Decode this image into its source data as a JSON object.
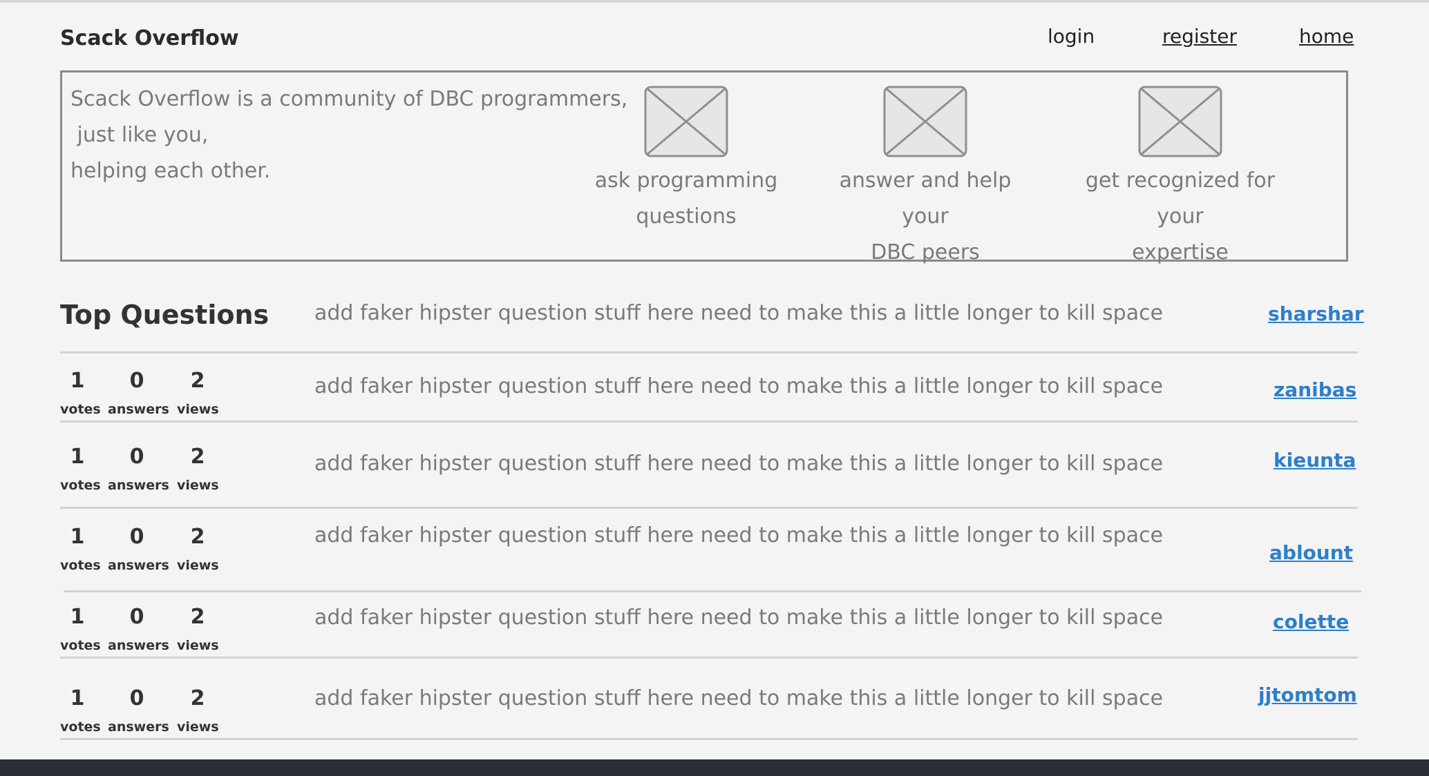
{
  "header": {
    "brand": "Scack Overflow",
    "nav": {
      "login": "login",
      "register": "register",
      "home": "home"
    }
  },
  "hero": {
    "lines": [
      "Scack Overflow is a community of DBC programmers,",
      " just like you,",
      "helping each other."
    ],
    "features": [
      {
        "line1": "ask programming",
        "line2": "questions",
        "icon": "image-placeholder-icon"
      },
      {
        "line1": "answer and help your",
        "line2": "DBC peers",
        "icon": "image-placeholder-icon"
      },
      {
        "line1": "get recognized for your",
        "line2": "expertise",
        "icon": "image-placeholder-icon"
      }
    ]
  },
  "top_questions": {
    "title": "Top Questions",
    "header_question": {
      "title": "add faker hipster question stuff here need to make this a little longer to kill space",
      "author": "sharshar"
    },
    "labels": {
      "votes": "votes",
      "answers": "answers",
      "views": "views"
    },
    "rows": [
      {
        "votes": "1",
        "answers": "0",
        "views": "2",
        "title": "add faker hipster question stuff here need to make this a little longer to kill space",
        "author": "zanibas"
      },
      {
        "votes": "1",
        "answers": "0",
        "views": "2",
        "title": "add faker hipster question stuff here need to make this a little longer to kill space",
        "author": "kieunta"
      },
      {
        "votes": "1",
        "answers": "0",
        "views": "2",
        "title": "add faker hipster question stuff here need to make this a little longer to kill space",
        "author": "ablount"
      },
      {
        "votes": "1",
        "answers": "0",
        "views": "2",
        "title": "add faker hipster question stuff here need to make this a little longer to kill space",
        "author": "colette"
      },
      {
        "votes": "1",
        "answers": "0",
        "views": "2",
        "title": "add faker hipster question stuff here need to make this a little longer to kill space",
        "author": "jjtomtom"
      }
    ]
  },
  "colors": {
    "background": "#f4f4f4",
    "link": "#2e7fc8",
    "muted_text": "#7a7a7a",
    "footer": "#2a2f36"
  }
}
